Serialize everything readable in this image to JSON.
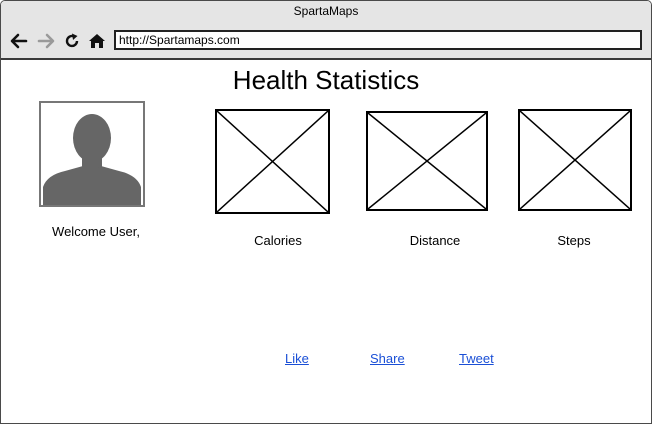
{
  "window": {
    "title": "SpartaMaps"
  },
  "toolbar": {
    "back_icon": "arrow-left-icon",
    "forward_icon": "arrow-right-icon",
    "reload_icon": "reload-icon",
    "home_icon": "home-icon",
    "url": "http://Spartamaps.com"
  },
  "page": {
    "title": "Health Statistics",
    "welcome": "Welcome User,",
    "avatar_icon": "user-silhouette-icon",
    "stats": [
      {
        "label": "Calories",
        "image_icon": "image-placeholder-icon"
      },
      {
        "label": "Distance",
        "image_icon": "image-placeholder-icon"
      },
      {
        "label": "Steps",
        "image_icon": "image-placeholder-icon"
      }
    ],
    "social": [
      {
        "label": "Like"
      },
      {
        "label": "Share"
      },
      {
        "label": "Tweet"
      }
    ]
  },
  "colors": {
    "link": "#1a4fd6",
    "titlebar": "#e5e5e5",
    "avatar_fill": "#666666"
  }
}
